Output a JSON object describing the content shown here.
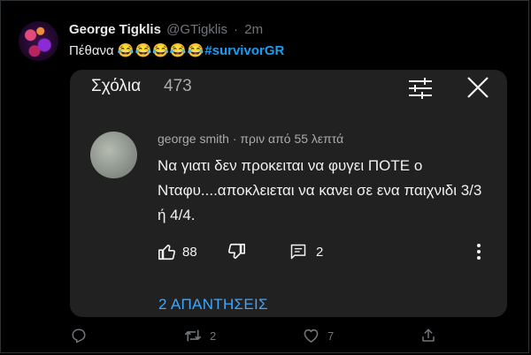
{
  "tweet": {
    "author_name": "George Tigklis",
    "handle": "@GTigklis",
    "separator": "·",
    "time": "2m",
    "text": "Πέθανα",
    "emojis": "😂😂😂😂😂",
    "hashtag": "#survivorGR"
  },
  "embed": {
    "title": "Σχόλια",
    "count": "473",
    "comment": {
      "author": "george smith",
      "separator": "·",
      "time": "πριν από 55 λεπτά",
      "text": "Να γιατι δεν προκειται να φυγει ΠΟΤΕ ο Νταφυ....αποκλειεται να κανει σε ενα παιχνιδι 3/3 ή 4/4.",
      "likes": "88",
      "replies_count": "2",
      "replies_link": "2 ΑΠΑΝΤΗΣΕΙΣ"
    }
  },
  "footer": {
    "retweets": "2",
    "likes": "7"
  },
  "colors": {
    "link": "#1d9bf0",
    "youtube_link": "#3ea6ff",
    "card_bg": "#212121"
  },
  "icons": [
    "filter-sliders-icon",
    "close-icon",
    "thumbs-up-icon",
    "thumbs-down-icon",
    "comment-icon",
    "more-vertical-icon",
    "reply-icon",
    "retweet-icon",
    "heart-icon",
    "share-icon"
  ]
}
